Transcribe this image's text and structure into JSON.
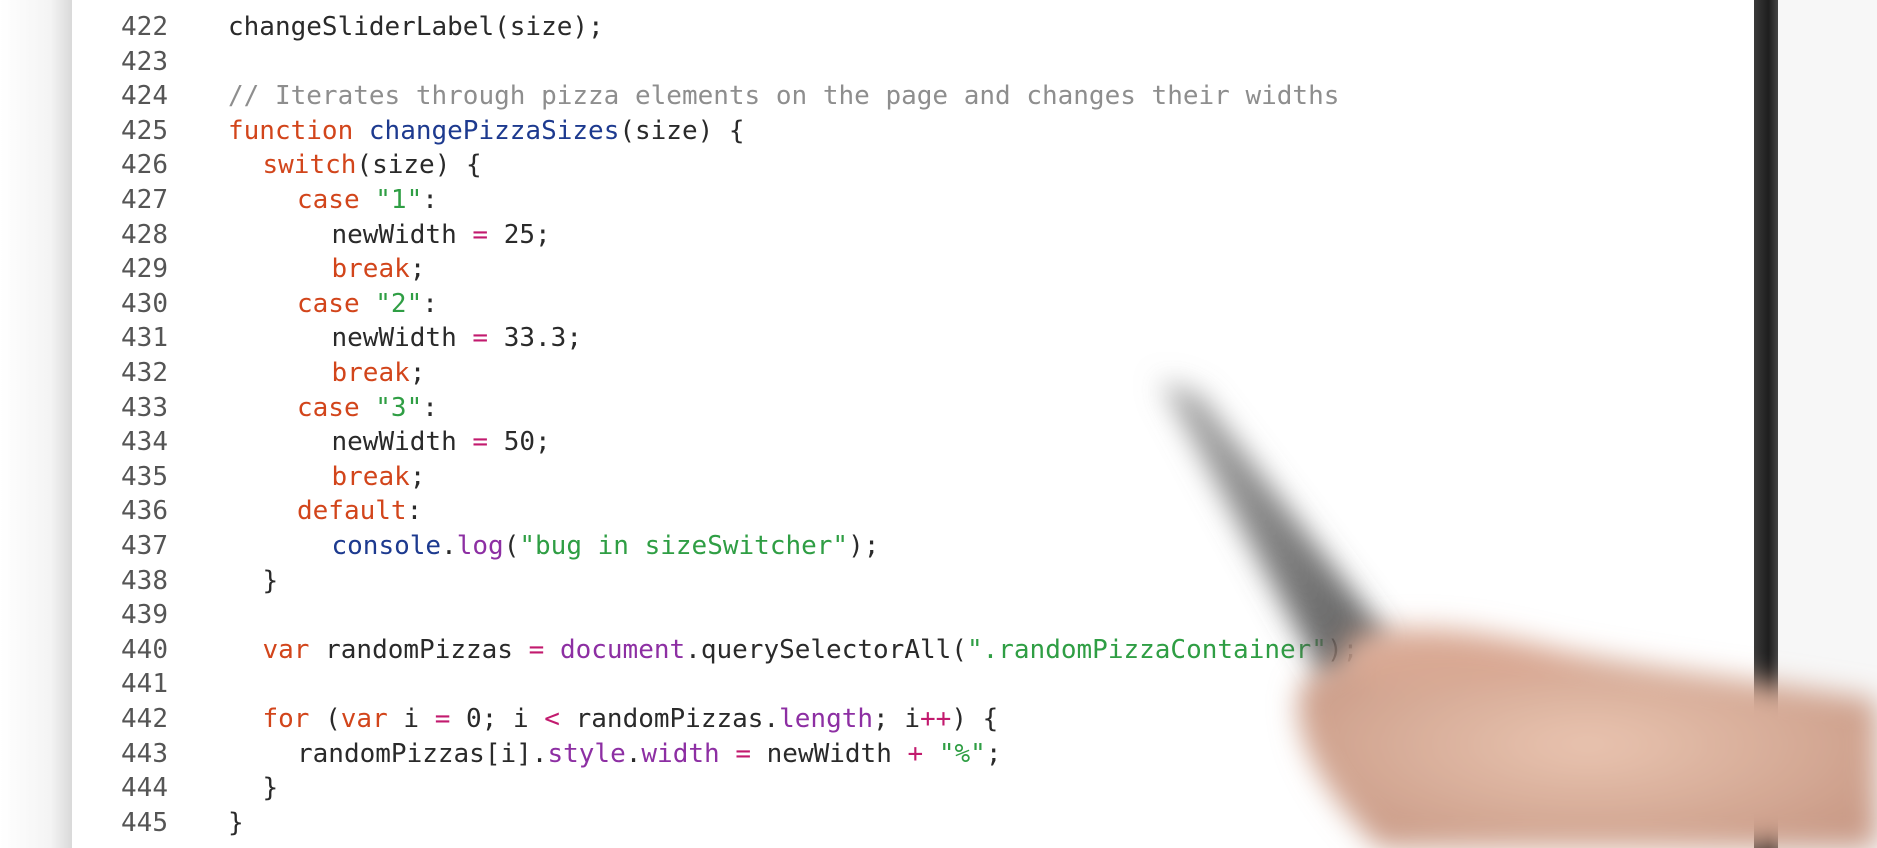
{
  "editor": {
    "lines": [
      {
        "number": "422",
        "indent": 0,
        "tokens": [
          {
            "t": "plain",
            "v": "changeSliderLabel(size);"
          }
        ]
      },
      {
        "number": "423",
        "indent": 0,
        "tokens": []
      },
      {
        "number": "424",
        "indent": 0,
        "tokens": [
          {
            "t": "cmt",
            "v": "// Iterates through pizza elements on the page and changes their widths"
          }
        ]
      },
      {
        "number": "425",
        "indent": 0,
        "tokens": [
          {
            "t": "kw",
            "v": "function"
          },
          {
            "t": "plain",
            "v": " "
          },
          {
            "t": "fn",
            "v": "changePizzaSizes"
          },
          {
            "t": "plain",
            "v": "(size) {"
          }
        ]
      },
      {
        "number": "426",
        "indent": 1,
        "tokens": [
          {
            "t": "kw",
            "v": "switch"
          },
          {
            "t": "plain",
            "v": "(size) {"
          }
        ]
      },
      {
        "number": "427",
        "indent": 2,
        "tokens": [
          {
            "t": "kw",
            "v": "case"
          },
          {
            "t": "plain",
            "v": " "
          },
          {
            "t": "str",
            "v": "\"1\""
          },
          {
            "t": "plain",
            "v": ":"
          }
        ]
      },
      {
        "number": "428",
        "indent": 3,
        "tokens": [
          {
            "t": "plain",
            "v": "newWidth "
          },
          {
            "t": "op",
            "v": "="
          },
          {
            "t": "plain",
            "v": " 25;"
          }
        ]
      },
      {
        "number": "429",
        "indent": 3,
        "tokens": [
          {
            "t": "kw",
            "v": "break"
          },
          {
            "t": "plain",
            "v": ";"
          }
        ]
      },
      {
        "number": "430",
        "indent": 2,
        "tokens": [
          {
            "t": "kw",
            "v": "case"
          },
          {
            "t": "plain",
            "v": " "
          },
          {
            "t": "str",
            "v": "\"2\""
          },
          {
            "t": "plain",
            "v": ":"
          }
        ]
      },
      {
        "number": "431",
        "indent": 3,
        "tokens": [
          {
            "t": "plain",
            "v": "newWidth "
          },
          {
            "t": "op",
            "v": "="
          },
          {
            "t": "plain",
            "v": " 33.3;"
          }
        ]
      },
      {
        "number": "432",
        "indent": 3,
        "tokens": [
          {
            "t": "kw",
            "v": "break"
          },
          {
            "t": "plain",
            "v": ";"
          }
        ]
      },
      {
        "number": "433",
        "indent": 2,
        "tokens": [
          {
            "t": "kw",
            "v": "case"
          },
          {
            "t": "plain",
            "v": " "
          },
          {
            "t": "str",
            "v": "\"3\""
          },
          {
            "t": "plain",
            "v": ":"
          }
        ]
      },
      {
        "number": "434",
        "indent": 3,
        "tokens": [
          {
            "t": "plain",
            "v": "newWidth "
          },
          {
            "t": "op",
            "v": "="
          },
          {
            "t": "plain",
            "v": " 50;"
          }
        ]
      },
      {
        "number": "435",
        "indent": 3,
        "tokens": [
          {
            "t": "kw",
            "v": "break"
          },
          {
            "t": "plain",
            "v": ";"
          }
        ]
      },
      {
        "number": "436",
        "indent": 2,
        "tokens": [
          {
            "t": "kw",
            "v": "default"
          },
          {
            "t": "plain",
            "v": ":"
          }
        ]
      },
      {
        "number": "437",
        "indent": 3,
        "tokens": [
          {
            "t": "fn",
            "v": "console"
          },
          {
            "t": "plain",
            "v": "."
          },
          {
            "t": "prop",
            "v": "log"
          },
          {
            "t": "plain",
            "v": "("
          },
          {
            "t": "str",
            "v": "\"bug in sizeSwitcher\""
          },
          {
            "t": "plain",
            "v": ");"
          }
        ]
      },
      {
        "number": "438",
        "indent": 1,
        "tokens": [
          {
            "t": "plain",
            "v": "}"
          }
        ]
      },
      {
        "number": "439",
        "indent": 0,
        "tokens": []
      },
      {
        "number": "440",
        "indent": 1,
        "tokens": [
          {
            "t": "kw",
            "v": "var"
          },
          {
            "t": "plain",
            "v": " randomPizzas "
          },
          {
            "t": "op",
            "v": "="
          },
          {
            "t": "plain",
            "v": " "
          },
          {
            "t": "prop",
            "v": "document"
          },
          {
            "t": "plain",
            "v": ".querySelectorAll("
          },
          {
            "t": "str",
            "v": "\".randomPizzaContainer\""
          },
          {
            "t": "plain",
            "v": ");"
          }
        ]
      },
      {
        "number": "441",
        "indent": 0,
        "tokens": []
      },
      {
        "number": "442",
        "indent": 1,
        "tokens": [
          {
            "t": "kw",
            "v": "for"
          },
          {
            "t": "plain",
            "v": " ("
          },
          {
            "t": "kw",
            "v": "var"
          },
          {
            "t": "plain",
            "v": " i "
          },
          {
            "t": "op",
            "v": "="
          },
          {
            "t": "plain",
            "v": " 0; i "
          },
          {
            "t": "op",
            "v": "<"
          },
          {
            "t": "plain",
            "v": " randomPizzas."
          },
          {
            "t": "prop",
            "v": "length"
          },
          {
            "t": "plain",
            "v": "; i"
          },
          {
            "t": "op",
            "v": "++"
          },
          {
            "t": "plain",
            "v": ") {"
          }
        ]
      },
      {
        "number": "443",
        "indent": 2,
        "tokens": [
          {
            "t": "plain",
            "v": "randomPizzas[i]."
          },
          {
            "t": "prop",
            "v": "style"
          },
          {
            "t": "plain",
            "v": "."
          },
          {
            "t": "prop",
            "v": "width"
          },
          {
            "t": "plain",
            "v": " "
          },
          {
            "t": "op",
            "v": "="
          },
          {
            "t": "plain",
            "v": " newWidth "
          },
          {
            "t": "op",
            "v": "+"
          },
          {
            "t": "plain",
            "v": " "
          },
          {
            "t": "str",
            "v": "\"%\""
          },
          {
            "t": "plain",
            "v": ";"
          }
        ]
      },
      {
        "number": "444",
        "indent": 1,
        "tokens": [
          {
            "t": "plain",
            "v": "}"
          }
        ]
      },
      {
        "number": "445",
        "indent": 0,
        "tokens": [
          {
            "t": "plain",
            "v": "}"
          }
        ]
      }
    ]
  },
  "overlay": {
    "pointer_icon": "hand-pointer-icon"
  }
}
